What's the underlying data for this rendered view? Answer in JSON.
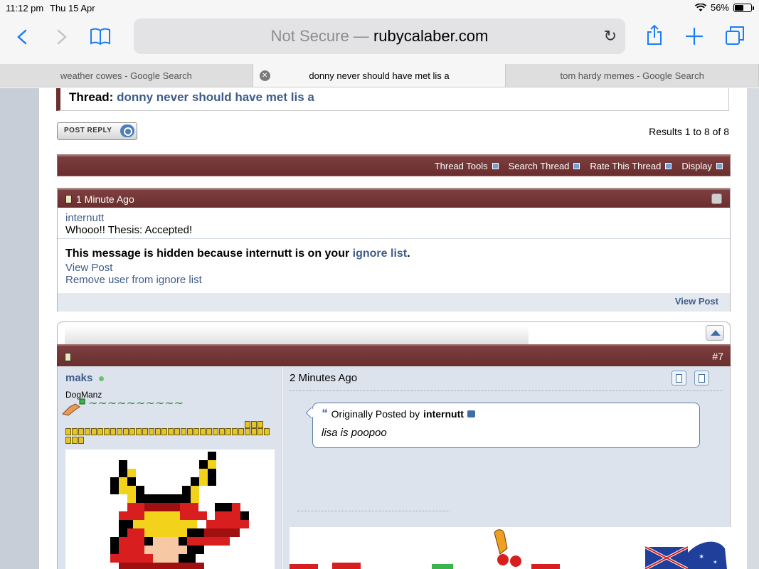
{
  "status": {
    "time": "11:12 pm",
    "date": "Thu 15 Apr",
    "battery": "56%"
  },
  "toolbar": {
    "url_prefix": "Not Secure —",
    "url_domain": "rubycalaber.com"
  },
  "tabs": [
    {
      "title": "weather cowes - Google Search"
    },
    {
      "title": "donny never should have met lis a"
    },
    {
      "title": "tom hardy memes - Google Search"
    }
  ],
  "thread": {
    "label": "Thread:",
    "title": "donny never should have met lis a"
  },
  "post_reply": "POST REPLY",
  "results": "Results 1 to 8 of 8",
  "tools": [
    "Thread Tools",
    "Search Thread",
    "Rate This Thread",
    "Display"
  ],
  "post6": {
    "time": "1 Minute Ago",
    "user": "internutt",
    "title": "Whooo!! Thesis: Accepted!",
    "hidden_prefix": "This message is hidden because internutt is on your",
    "ignore_link": "ignore list",
    "hidden_suffix": ".",
    "view_post": "View Post",
    "remove_ignore": "Remove user from ignore list",
    "footer_view": "View Post"
  },
  "post7": {
    "number": "#7",
    "user": "maks",
    "user_title": "DogManz",
    "time": "2 Minutes Ago",
    "quote_label": "Originally Posted by",
    "quote_author": "internutt",
    "quote_text": "lisa is poopoo",
    "rep_glyphs": "~~~~~~~~~~"
  },
  "colors": {
    "accent": "#1a7ef5",
    "maroon": "#6a2e2e",
    "link": "#3e5c8a"
  }
}
